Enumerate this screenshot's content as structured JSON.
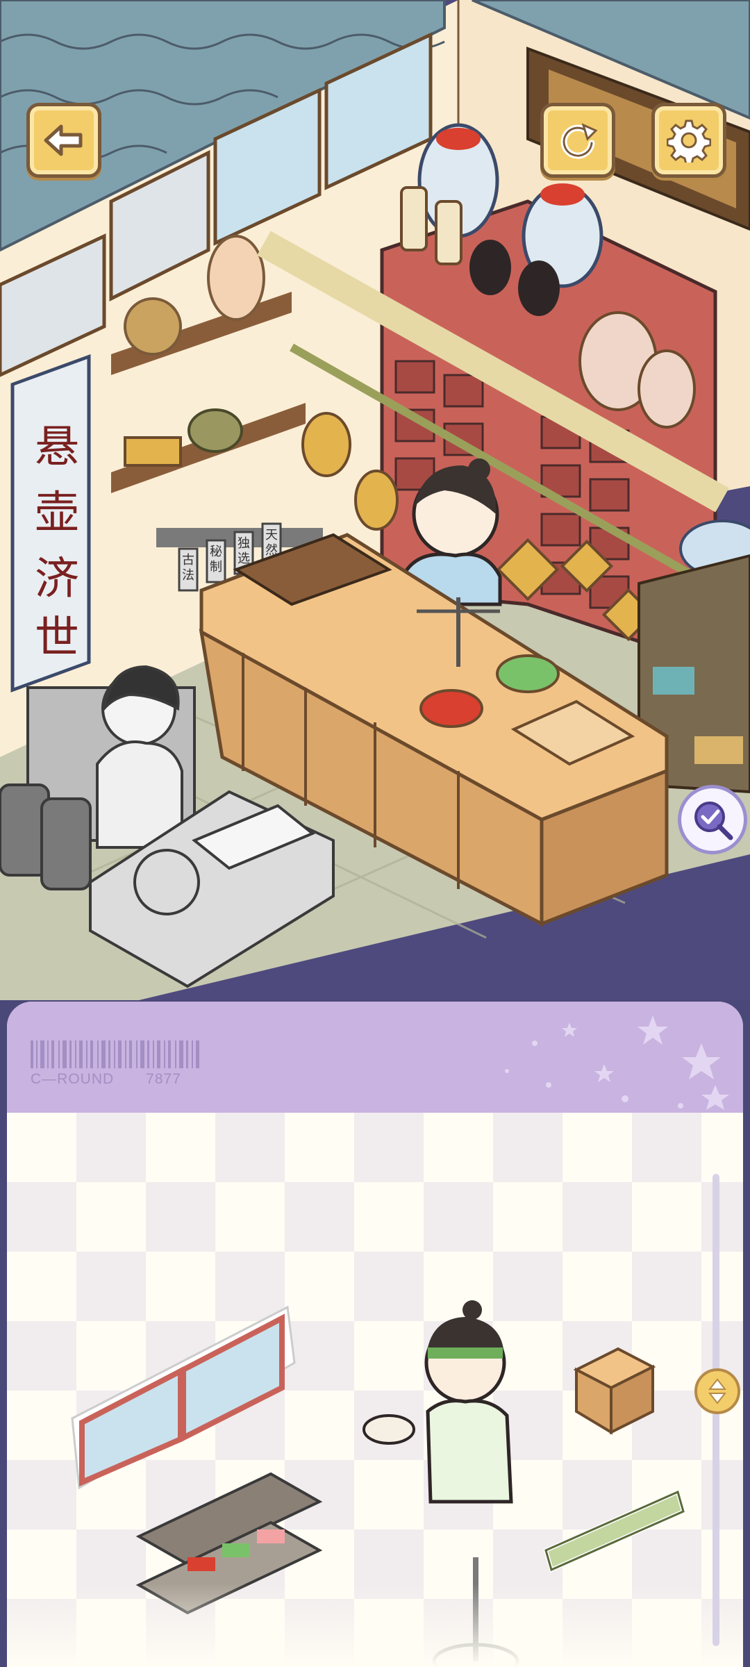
{
  "game": {
    "scroll_chars": [
      "悬",
      "壶",
      "济",
      "世"
    ],
    "tag_chars": [
      "古法",
      "秘制",
      "独选",
      "天然"
    ],
    "round_prefix": "C—ROUND",
    "round_number": "7877"
  },
  "buttons": {
    "back_icon": "arrow-left-icon",
    "reset_icon": "reset-icon",
    "settings_icon": "gear-icon",
    "hint_icon": "magnifier-check-icon"
  },
  "tray": {
    "pieces": [
      "window-frame",
      "shopkeeper-boy",
      "wooden-stool",
      "herb-shelf",
      "green-bar",
      "pole-stand"
    ]
  },
  "colors": {
    "accent": "#f3cd6a",
    "tray_header": "#c9b3e0",
    "wall": "#fbeed6",
    "roof": "#7fa1ad"
  }
}
